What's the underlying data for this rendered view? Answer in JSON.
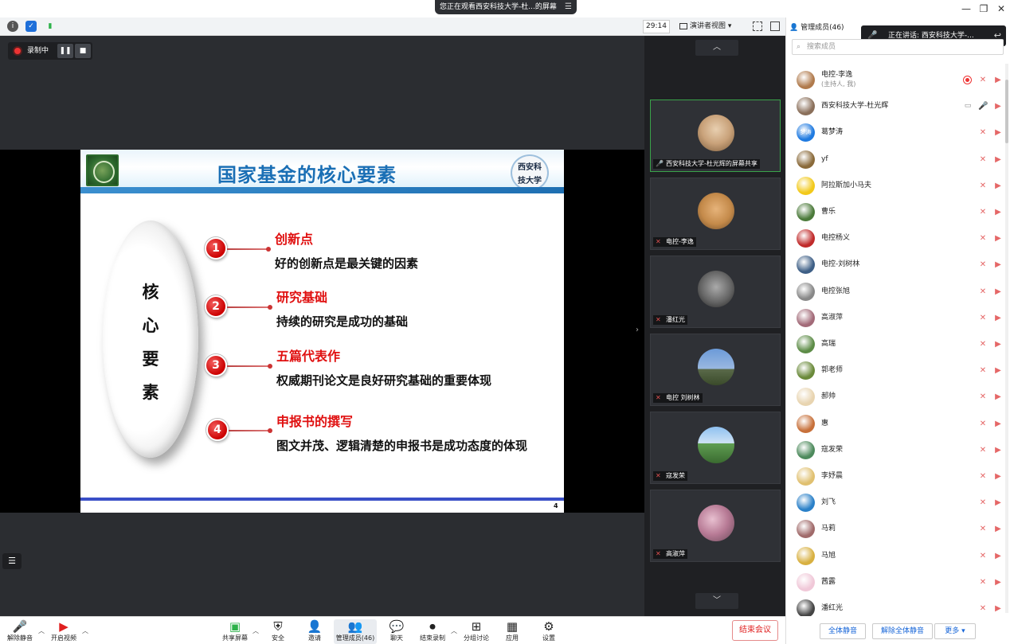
{
  "window": {
    "share_banner": "您正在观看西安科技大学-杜...的屏幕",
    "min_icon": "—",
    "restore_icon": "❐",
    "close_icon": "✕"
  },
  "toolbar": {
    "timer": "29:14",
    "view_label": "演讲者视图 ▾"
  },
  "recording": {
    "label": "录制中",
    "pause": "❚❚",
    "stop": "■"
  },
  "slide": {
    "title": "国家基金的核心要素",
    "badge_line1": "西安科",
    "badge_line2": "技大学",
    "oval_chars": [
      "核",
      "心",
      "要",
      "素"
    ],
    "items": [
      {
        "num": "1",
        "head": "创新点",
        "desc": "好的创新点是最关键的因素"
      },
      {
        "num": "2",
        "head": "研究基础",
        "desc": "持续的研究是成功的基础"
      },
      {
        "num": "3",
        "head": "五篇代表作",
        "desc": "权威期刊论文是良好研究基础的重要体现"
      },
      {
        "num": "4",
        "head": "申报书的撰写",
        "desc": "图文并茂、逻辑清楚的申报书是成功态度的体现"
      }
    ],
    "page": "4"
  },
  "gallery": {
    "up_arrow": "︿",
    "down_arrow": "﹀",
    "tiles": [
      {
        "name": "西安科技大学-杜光辉的屏幕共享",
        "color": "#c9a27a"
      },
      {
        "name": "电控-李逸",
        "color": "#c48a4a"
      },
      {
        "name": "潘红光",
        "color": "#666666"
      },
      {
        "name": "电控 刘树林",
        "color": "#6b87b0"
      },
      {
        "name": "寇发荣",
        "color": "#5f9e52"
      },
      {
        "name": "高淑萍",
        "color": "#b77a95"
      }
    ]
  },
  "panel": {
    "title": "管理成员(46)",
    "speaking": "正在讲话: 西安科技大学-...",
    "search_placeholder": "搜索成员",
    "members": [
      {
        "name": "电控-李逸",
        "sub": "(主持人, 我)",
        "color": "#b07a4c",
        "rec": true
      },
      {
        "name": "西安科技大学-杜光辉",
        "color": "#8a6f5a",
        "screen": true,
        "mic_on": true
      },
      {
        "name": "葛梦涛",
        "color": "#1f7ae0",
        "initials": "梦涛"
      },
      {
        "name": "yf",
        "color": "#8a6a3a"
      },
      {
        "name": "阿拉斯加小马夫",
        "color": "#f2c91a"
      },
      {
        "name": "曹乐",
        "color": "#4b7a3a"
      },
      {
        "name": "电控杨义",
        "color": "#c02a2a"
      },
      {
        "name": "电控-刘树林",
        "color": "#3e5f86"
      },
      {
        "name": "电控张旭",
        "color": "#888888"
      },
      {
        "name": "高淑萍",
        "color": "#a26a78"
      },
      {
        "name": "高瑞",
        "color": "#5d8c47"
      },
      {
        "name": "郭老师",
        "color": "#6a8a3a"
      },
      {
        "name": "郝帅",
        "color": "#e8d4b0"
      },
      {
        "name": "惠",
        "color": "#c7703a"
      },
      {
        "name": "寇发荣",
        "color": "#4d8a5c"
      },
      {
        "name": "李妤晨",
        "color": "#e0c070"
      },
      {
        "name": "刘飞",
        "color": "#2a80c8"
      },
      {
        "name": "马莉",
        "color": "#a06a6a"
      },
      {
        "name": "马旭",
        "color": "#d8b040"
      },
      {
        "name": "茜露",
        "color": "#f0c8d8"
      },
      {
        "name": "潘红光",
        "color": "#444444"
      }
    ],
    "mute_all": "全体静音",
    "unmute_all": "解除全体静音",
    "more": "更多 ▾"
  },
  "bottombar": {
    "unmute": "解除静音",
    "video": "开启视频",
    "share": "共享屏幕",
    "security": "安全",
    "invite": "邀请",
    "members": "管理成员(46)",
    "chat": "聊天",
    "end_record": "结束录制",
    "breakout": "分组讨论",
    "apps": "应用",
    "settings": "设置",
    "end_meeting": "结束会议"
  },
  "colors": {
    "accent_blue": "#1665d8",
    "danger_red": "#e02020",
    "slide_title_blue": "#1a6fb5"
  }
}
